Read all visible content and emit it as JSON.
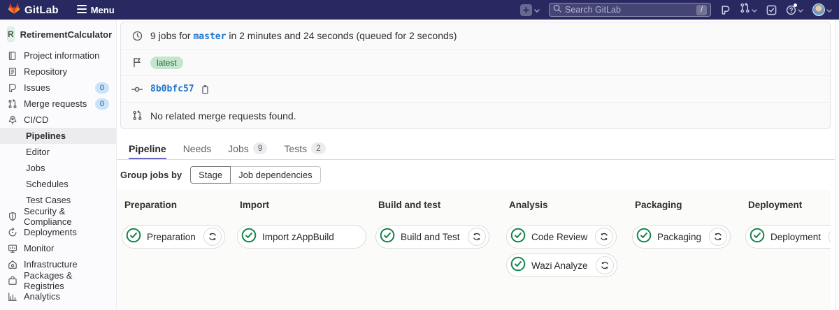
{
  "topbar": {
    "brand": "GitLab",
    "menu_label": "Menu",
    "search_placeholder": "Search GitLab",
    "search_shortcut": "/"
  },
  "sidebar": {
    "project_initial": "R",
    "project_name": "RetirementCalculator",
    "items": [
      {
        "label": "Project information"
      },
      {
        "label": "Repository"
      },
      {
        "label": "Issues",
        "badge": "0"
      },
      {
        "label": "Merge requests",
        "badge": "0"
      },
      {
        "label": "CI/CD"
      },
      {
        "label": "Pipelines",
        "active": true
      },
      {
        "label": "Editor"
      },
      {
        "label": "Jobs"
      },
      {
        "label": "Schedules"
      },
      {
        "label": "Test Cases"
      },
      {
        "label": "Security & Compliance"
      },
      {
        "label": "Deployments"
      },
      {
        "label": "Monitor"
      },
      {
        "label": "Infrastructure"
      },
      {
        "label": "Packages & Registries"
      },
      {
        "label": "Analytics"
      }
    ]
  },
  "pipeline_info": {
    "jobs_summary_prefix": "9 jobs for ",
    "branch": "master",
    "jobs_summary_suffix": " in 2 minutes and 24 seconds (queued for 2 seconds)",
    "latest_badge": "latest",
    "commit_sha": "8b0bfc57",
    "merge_request_note": "No related merge requests found."
  },
  "tabs": [
    {
      "label": "Pipeline",
      "active": true
    },
    {
      "label": "Needs"
    },
    {
      "label": "Jobs",
      "badge": "9"
    },
    {
      "label": "Tests",
      "badge": "2"
    }
  ],
  "group_jobs": {
    "label": "Group jobs by",
    "options": [
      "Stage",
      "Job dependencies"
    ],
    "selected": "Stage"
  },
  "stages": [
    {
      "name": "Preparation",
      "jobs": [
        {
          "name": "Preparation",
          "status": "success",
          "retry": true
        }
      ]
    },
    {
      "name": "Import",
      "jobs": [
        {
          "name": "Import zAppBuild",
          "status": "success",
          "retry": false
        }
      ]
    },
    {
      "name": "Build and test",
      "jobs": [
        {
          "name": "Build and Test",
          "status": "success",
          "retry": true
        }
      ]
    },
    {
      "name": "Analysis",
      "jobs": [
        {
          "name": "Code Review",
          "status": "success",
          "retry": true
        },
        {
          "name": "Wazi Analyze",
          "status": "success",
          "retry": true
        }
      ]
    },
    {
      "name": "Packaging",
      "jobs": [
        {
          "name": "Packaging",
          "status": "success",
          "retry": true
        }
      ]
    },
    {
      "name": "Deployment",
      "jobs": [
        {
          "name": "Deployment",
          "status": "success",
          "retry": true
        }
      ]
    }
  ],
  "colors": {
    "navbar_bg": "#292961",
    "link_blue": "#1f75cb",
    "success_green": "#108548",
    "latest_badge_bg": "#c3e6cd",
    "latest_badge_text": "#24663b",
    "count_badge_bg": "#cbe2f9",
    "count_badge_text": "#0b5cad",
    "active_tab_underline": "#6666c4"
  }
}
